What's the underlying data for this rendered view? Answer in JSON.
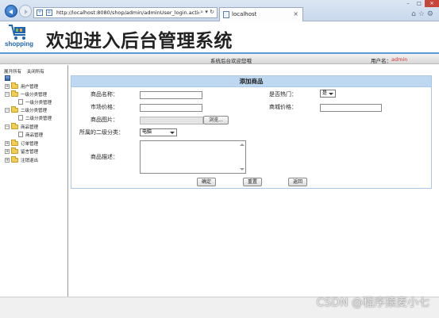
{
  "browser": {
    "url": "http://localhost:8080/shop/admin/adminUser_login.action",
    "tab_title": "localhost",
    "tab_close": "×",
    "url_tools": "⌕ ▾ ↻"
  },
  "header": {
    "logo_text": "shopping",
    "title": "欢迎进入后台管理系统"
  },
  "status": {
    "welcome": "系统后台欢迎您哦",
    "user_label": "用户名：",
    "user_name": "admin"
  },
  "sidebar": {
    "expand_all": "展开所有",
    "collapse_all": "关闭所有",
    "nodes": [
      {
        "label": "用户管理",
        "type": "folder",
        "expanded": false
      },
      {
        "label": "一级分类管理",
        "type": "folder",
        "expanded": true
      },
      {
        "label": "一级分类管理",
        "type": "page"
      },
      {
        "label": "二级分类管理",
        "type": "folder",
        "expanded": true
      },
      {
        "label": "二级分类管理",
        "type": "page"
      },
      {
        "label": "商品管理",
        "type": "folder",
        "expanded": true
      },
      {
        "label": "商品管理",
        "type": "page"
      },
      {
        "label": "订单管理",
        "type": "folder",
        "expanded": false
      },
      {
        "label": "留言管理",
        "type": "folder",
        "expanded": false
      },
      {
        "label": "注销退出",
        "type": "folder",
        "expanded": false
      }
    ]
  },
  "form": {
    "title": "添加商品",
    "name_label": "商品名称：",
    "hot_label": "是否热门：",
    "hot_value": "是",
    "market_price_label": "市场价格：",
    "shop_price_label": "商城价格：",
    "image_label": "商品图片：",
    "browse_button": "浏览...",
    "category_label": "所属的二级分类：",
    "category_value": "电脑",
    "desc_label": "商品描述：",
    "confirm_button": "确定",
    "reset_button": "重置",
    "back_button": "返回"
  },
  "watermark": "CSDN @程序猿麦小七",
  "colors": {
    "header_accent": "#5c9ad6",
    "form_header_bg": "#bed8f2",
    "username": "#e03030"
  }
}
